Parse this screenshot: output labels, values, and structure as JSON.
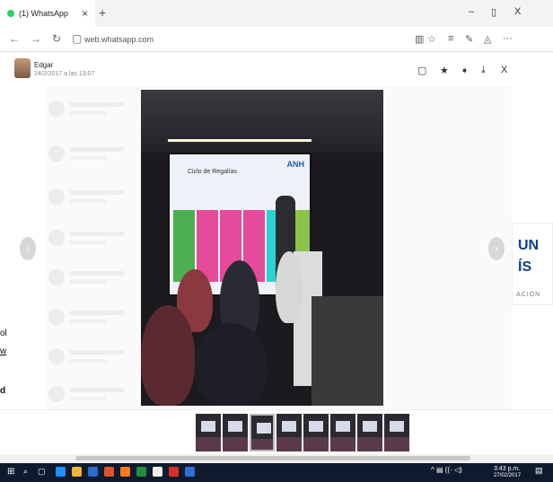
{
  "browser": {
    "tab_title": "(1) WhatsApp",
    "tab_close": "×",
    "new_tab": "+",
    "url": "web.whatsapp.com",
    "win_minimize": "–",
    "win_restore": "▯",
    "win_close": "X"
  },
  "viewer": {
    "sender": "Edgar",
    "timestamp": "24/2/2017 a las 13:07",
    "prev_arrow": "‹",
    "next_arrow": "›"
  },
  "photo": {
    "screen_title": "Ciclo de Regalías",
    "screen_logo": "ANH"
  },
  "side_text": {
    "line1": "ol",
    "line2": "w",
    "line3": "d"
  },
  "brand": {
    "line1": "UN",
    "line2": "ÍS",
    "line3": "ACIÓN"
  },
  "thumbnails": {
    "count": 8,
    "active_index": 2
  },
  "taskbar": {
    "time": "3:43 p.m.",
    "date": "27/02/2017"
  },
  "colors": {
    "whatsapp_green": "#25d366",
    "taskbar": "#0f1a2e",
    "brand_blue": "#0a3f8c"
  }
}
